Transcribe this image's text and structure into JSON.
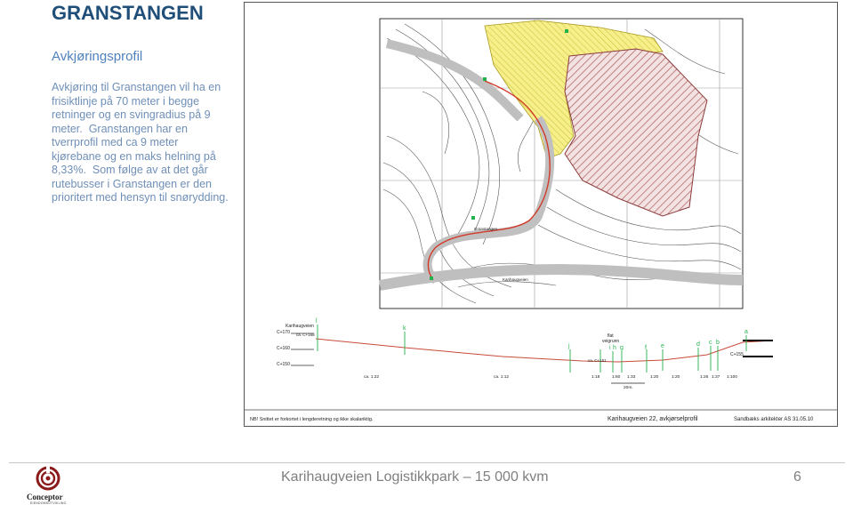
{
  "slide": {
    "title": "GRANSTANGEN",
    "subtitle": "Avkjøringsprofil",
    "paragraph_1": "Avkjøring til Granstangen vil ha en frisiktlinje på 70 meter i begge retninger og en svingradius på 9 meter.",
    "paragraph_2": "Granstangen har en tverrprofil med ca 9 meter kjørebane og en maks helning på 8,33%.",
    "paragraph_3": "Som følge av at det går rutebusser i Granstangen er den prioritert med hensyn til snørydding."
  },
  "map": {
    "road_label_upper": "Granstangen",
    "road_label_lower": "Karihaugveien"
  },
  "profile": {
    "road_name": "Karihaugveien",
    "elev_170": "C+170",
    "elev_160": "C+160",
    "elev_150": "C+150",
    "point_start": "ca. C+168",
    "point_low": "ca. C+151",
    "point_end": "C+155",
    "flat_label_1": "flat",
    "flat_label_2": "veigrunn",
    "slope_1": "ca. 1:22",
    "slope_2": "ca. 1:12",
    "slope_3": "1:18",
    "slope_4": "1:60",
    "slope_5": "1:33",
    "slope_6": "1:20",
    "slope_7": "1:20",
    "slope_8": "1:26",
    "slope_9": "1:37",
    "slope_10": "1:100",
    "scale_label": "20m.",
    "letter_l": "l",
    "letter_k": "k",
    "letter_j": "j",
    "letter_i": "i",
    "letter_h": "h",
    "letter_g": "g",
    "letter_f": "f",
    "letter_e": "e",
    "letter_d": "d",
    "letter_c": "c",
    "letter_b": "b",
    "letter_a": "a"
  },
  "drawing_footer": {
    "note": "NB! Snittet er forkortet i lengderetning og ikke skalariktig.",
    "caption": "Karihaugveien 22, avkjørselprofil",
    "architect": "Sandbæks arkitekter AS 31.05.10"
  },
  "footer": {
    "text": "Karihaugveien Logistikkpark – 15 000 kvm",
    "page": "6",
    "logo_name": "Conceptor",
    "logo_sub": "EIENDOMSUTVIKLING"
  },
  "colors": {
    "title": "#1f4e79",
    "subtitle": "#4f81bd",
    "body": "#6f8fb8",
    "site_hatch": "#b56a6a",
    "zone_yellow": "#f2ec7a",
    "road_red": "#d23a2a",
    "marker_green": "#22b24c"
  }
}
